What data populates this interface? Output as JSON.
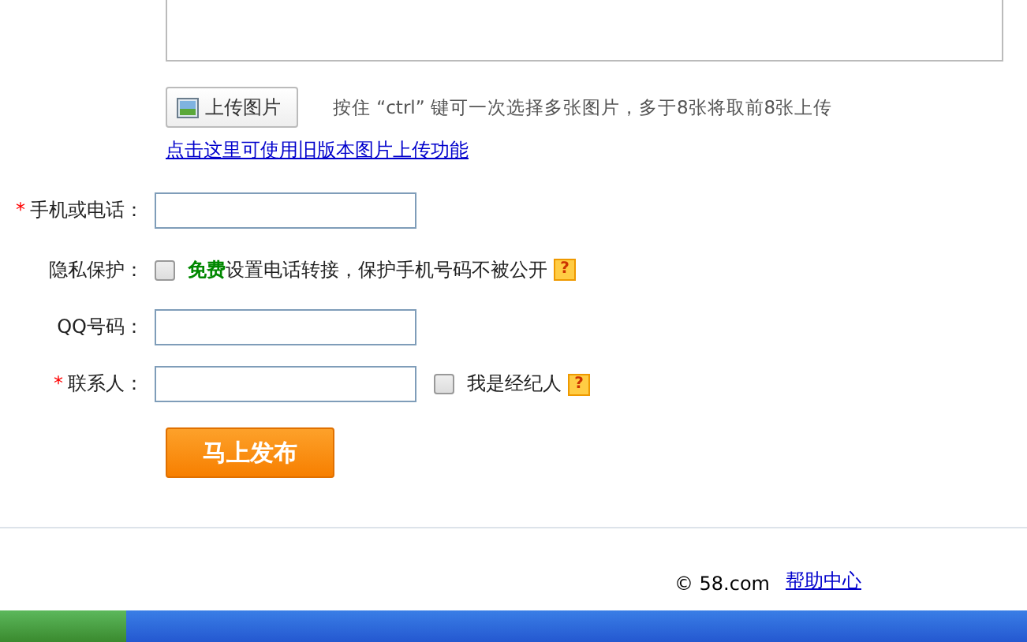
{
  "upload": {
    "button": "上传图片",
    "hint": "按住 “ctrl” 键可一次选择多张图片，多于8张将取前8张上传",
    "legacy_link": "点击这里可使用旧版本图片上传功能"
  },
  "form": [
    {
      "kind": "input",
      "label": "手机或电话：",
      "required": true
    },
    {
      "kind": "checkbox",
      "label": "隐私保护：",
      "required": false,
      "checked": false,
      "free": "免费",
      "text": "设置电话转接，保护手机号码不被公开"
    },
    {
      "kind": "input",
      "label": "QQ号码：",
      "required": false
    },
    {
      "kind": "input_check",
      "label": "联系人：",
      "required": true,
      "checked": false,
      "text": "我是经纪人"
    }
  ],
  "submit": "马上发布",
  "required_mark": "*",
  "help_mark": "?",
  "footer": {
    "copyright": "© 58.com",
    "help_link": "帮助中心"
  }
}
